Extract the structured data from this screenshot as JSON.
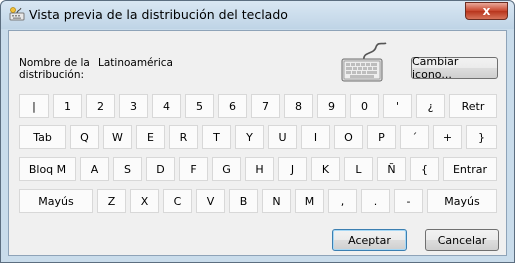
{
  "window": {
    "title": "Vista previa de la distribución del teclado",
    "close_label": "x"
  },
  "layout": {
    "name_label": "Nombre de la distribución:",
    "name_value": "Latinoamérica",
    "change_icon_label": "Cambiar icono..."
  },
  "keyboard": {
    "row1": [
      "|",
      "1",
      "2",
      "3",
      "4",
      "5",
      "6",
      "7",
      "8",
      "9",
      "0",
      "'",
      "¿",
      "Retr"
    ],
    "row2": [
      "Tab",
      "Q",
      "W",
      "E",
      "R",
      "T",
      "Y",
      "U",
      "I",
      "O",
      "P",
      "´",
      "+",
      "}"
    ],
    "row3": [
      "Bloq M",
      "A",
      "S",
      "D",
      "F",
      "G",
      "H",
      "J",
      "K",
      "L",
      "Ñ",
      "{",
      "Entrar"
    ],
    "row4": [
      "Mayús",
      "Z",
      "X",
      "C",
      "V",
      "B",
      "N",
      "M",
      ",",
      ".",
      "-",
      "Mayús"
    ]
  },
  "footer": {
    "ok_label": "Aceptar",
    "cancel_label": "Cancelar"
  },
  "icons": {
    "title": "keyboard-icon",
    "layout": "keyboard-icon"
  },
  "colors": {
    "titlebar": "#c9dceb",
    "client": "#f0f0f0",
    "close": "#c7452c",
    "key": "#fbfbfb"
  }
}
